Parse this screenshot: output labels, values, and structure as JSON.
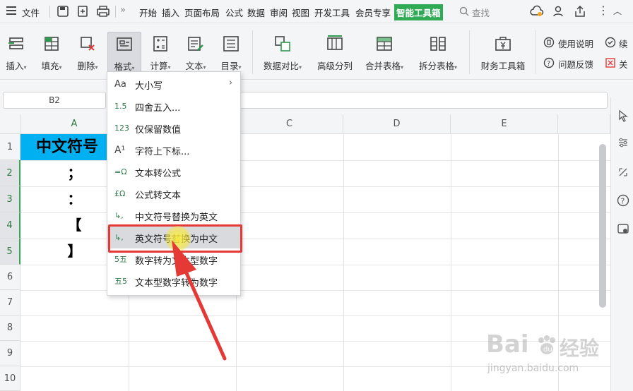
{
  "menubar": {
    "file_label": "文件",
    "tabs": [
      "开始",
      "插入",
      "页面布局",
      "公式",
      "数据",
      "审阅",
      "视图",
      "开发工具",
      "会员专享",
      "智能工具箱"
    ],
    "search_label": "查找"
  },
  "ribbon": {
    "buttons": [
      {
        "label": "插入",
        "caret": "▾"
      },
      {
        "label": "填充",
        "caret": "▾"
      },
      {
        "label": "删除",
        "caret": "▾"
      },
      {
        "label": "格式",
        "caret": "▾"
      },
      {
        "label": "计算",
        "caret": "▾"
      },
      {
        "label": "文本",
        "caret": "▾"
      },
      {
        "label": "目录",
        "caret": "▾"
      },
      {
        "label": "数据对比",
        "caret": "▾"
      },
      {
        "label": "高级分列",
        "caret": ""
      },
      {
        "label": "合并表格",
        "caret": "▾"
      },
      {
        "label": "拆分表格",
        "caret": "▾"
      },
      {
        "label": "财务工具箱",
        "caret": ""
      }
    ],
    "help": [
      "使用说明",
      "问题反馈"
    ],
    "extra": [
      "续",
      "关"
    ]
  },
  "formula_bar": {
    "name_box": "B2"
  },
  "grid": {
    "columns": [
      "A",
      "C",
      "D",
      "E"
    ],
    "rows": [
      "1",
      "2",
      "3",
      "4",
      "5",
      "6",
      "7",
      "8",
      "9",
      "10"
    ],
    "cells": {
      "a1": "中文符号",
      "a2": "；",
      "a3": "：",
      "a4": "【",
      "a5": "】"
    }
  },
  "dropdown": {
    "items": [
      {
        "icon": "Aa",
        "label": "大小写",
        "submenu": "›"
      },
      {
        "icon": "1.5",
        "label": "四舍五入..."
      },
      {
        "icon": "123",
        "label": "仅保留数值"
      },
      {
        "icon": "A¹",
        "label": "字符上下标..."
      },
      {
        "icon": "=Ω",
        "label": "文本转公式"
      },
      {
        "icon": "£Ω",
        "label": "公式转文本"
      },
      {
        "icon": "↳,",
        "label": "中文符号替换为英文"
      },
      {
        "icon": "↳,",
        "label": "英文符号替换为中文"
      },
      {
        "icon": "5五",
        "label": "数字转为文本型数字"
      },
      {
        "icon": "五5",
        "label": "文本型数字转为数字"
      }
    ]
  },
  "watermark": {
    "brand": "Bai",
    "brand2": "经验",
    "url": "jingyan.baidu.com"
  },
  "colors": {
    "accent": "#2faa55",
    "header_cell": "#00b0f0",
    "annotation": "#e53935"
  }
}
